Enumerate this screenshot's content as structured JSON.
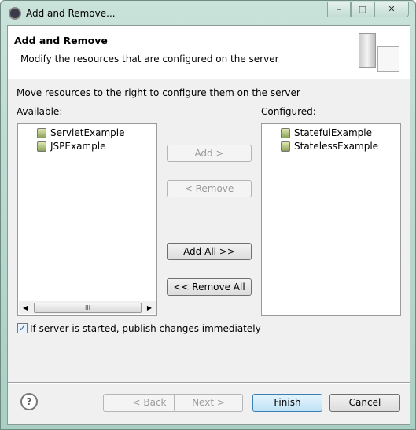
{
  "window": {
    "title": "Add and Remove...",
    "minimize": "–",
    "maximize": "□",
    "close": "✕"
  },
  "header": {
    "title": "Add and Remove",
    "subtitle": "Modify the resources that are configured on the server"
  },
  "instruction": "Move resources to the right to configure them on the server",
  "available": {
    "label": "Available:",
    "items": [
      "ServletExample",
      "JSPExample"
    ],
    "scroll_thumb": "III"
  },
  "configured": {
    "label": "Configured:",
    "items": [
      "StatefulExample",
      "StatelessExample"
    ]
  },
  "buttons": {
    "add": "Add >",
    "remove": "< Remove",
    "add_all": "Add All >>",
    "remove_all": "<< Remove All"
  },
  "publish_checkbox": {
    "label": "If server is started, publish changes immediately",
    "checked": true
  },
  "footer": {
    "help": "?",
    "back": "< Back",
    "next": "Next >",
    "finish": "Finish",
    "cancel": "Cancel"
  }
}
